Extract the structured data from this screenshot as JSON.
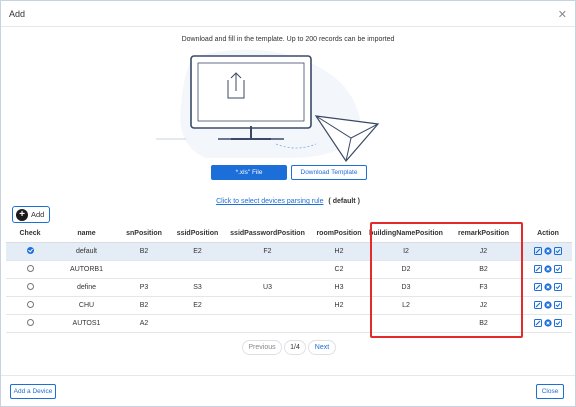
{
  "dialog": {
    "title": "Add"
  },
  "import": {
    "hint": "Download and fill in the template. Up to 200 records can be imported",
    "file_button": "*.xls\" File",
    "template_button": "Download Template",
    "rule_link": "Click to select devices parsing rule",
    "rule_value": "( default )"
  },
  "toolbar": {
    "add_label": "Add"
  },
  "table": {
    "headers": [
      "Check",
      "name",
      "snPosition",
      "ssidPosition",
      "ssidPasswordPosition",
      "roomPosition",
      "buildingNamePosition",
      "remarkPosition",
      "Action"
    ],
    "rows": [
      {
        "selected": true,
        "name": "default",
        "sn": "B2",
        "ssid": "E2",
        "ssidPassword": "F2",
        "room": "H2",
        "building": "I2",
        "remark": "J2"
      },
      {
        "selected": false,
        "name": "AUTORB1",
        "sn": "",
        "ssid": "",
        "ssidPassword": "",
        "room": "C2",
        "building": "D2",
        "remark": "B2"
      },
      {
        "selected": false,
        "name": "define",
        "sn": "P3",
        "ssid": "S3",
        "ssidPassword": "U3",
        "room": "H3",
        "building": "D3",
        "remark": "F3"
      },
      {
        "selected": false,
        "name": "CHU",
        "sn": "B2",
        "ssid": "E2",
        "ssidPassword": "",
        "room": "H2",
        "building": "L2",
        "remark": "J2"
      },
      {
        "selected": false,
        "name": "AUTOS1",
        "sn": "A2",
        "ssid": "",
        "ssidPassword": "",
        "room": "",
        "building": "",
        "remark": "B2"
      }
    ],
    "action_icons": [
      "edit-icon",
      "delete-icon",
      "check-icon"
    ]
  },
  "pagination": {
    "previous": "Previous",
    "page": "1/4",
    "next": "Next"
  },
  "footer": {
    "add_device": "Add a Device",
    "close": "Close"
  },
  "colors": {
    "accent": "#1c6ed8",
    "highlight": "#e52a2a",
    "selected_row": "#e4ecf6"
  }
}
